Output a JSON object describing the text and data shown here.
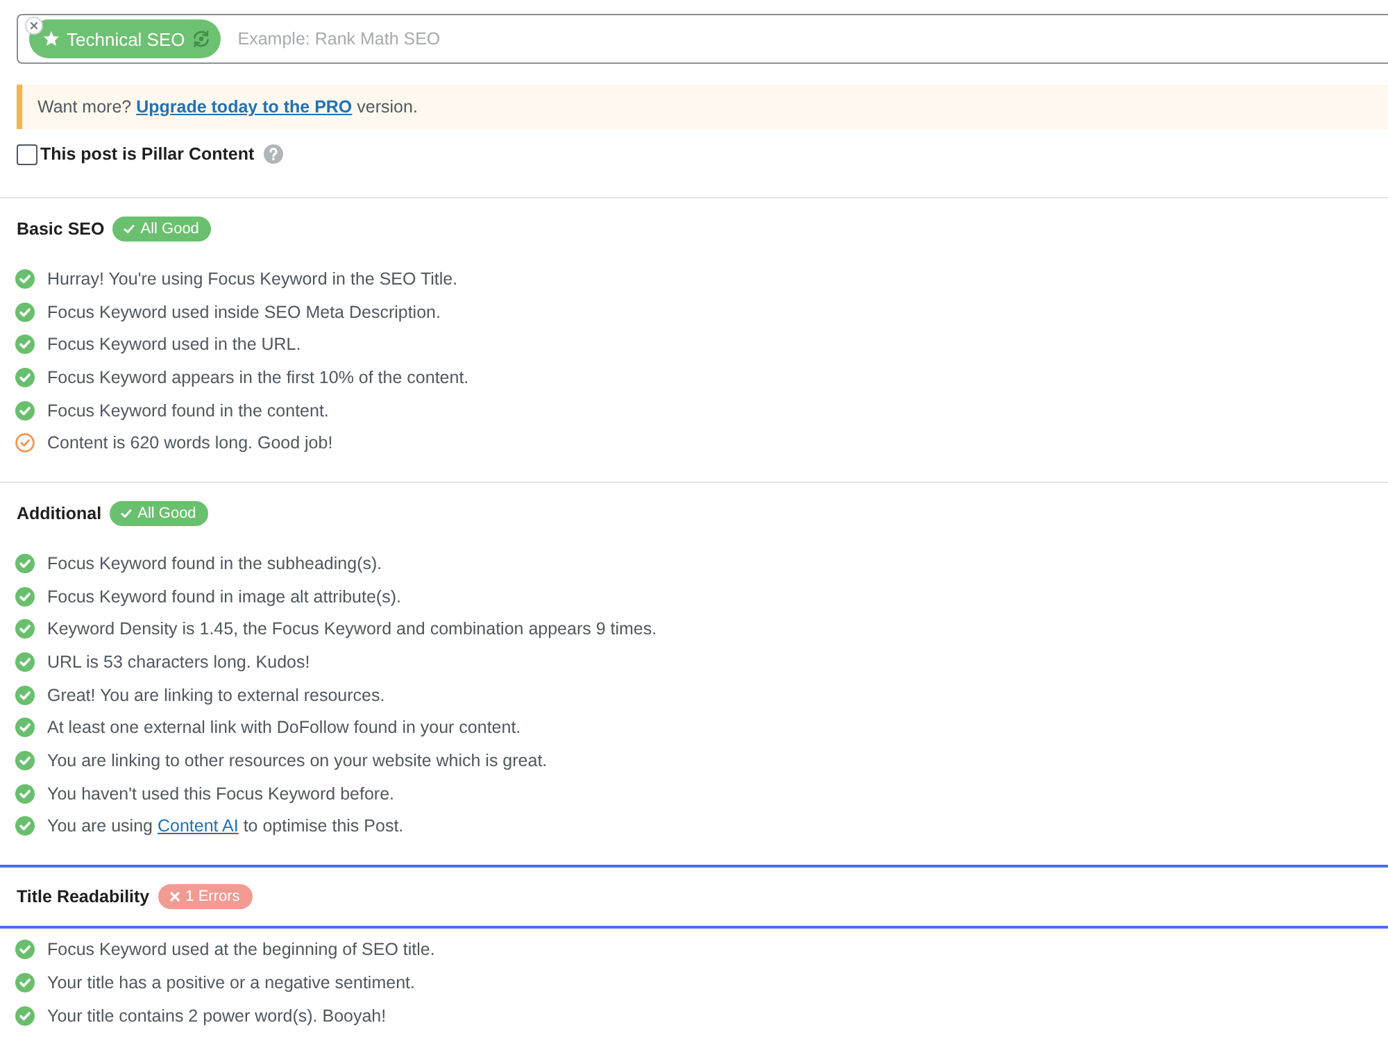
{
  "focus_keyword": {
    "tags": [
      {
        "label": "Technical SEO"
      }
    ],
    "placeholder": "Example: Rank Math SEO"
  },
  "notice": {
    "text": "Want more? ",
    "link": "Upgrade today to the PRO",
    "text_after": " version."
  },
  "pillar_content": {
    "label": "This post is Pillar Content",
    "checked": false
  },
  "sections": [
    {
      "title": "Basic SEO",
      "focused": false,
      "badge": {
        "kind": "good",
        "label": "All Good"
      },
      "items": [
        {
          "kind": "pass",
          "text": "Hurray! You're using Focus Keyword in the SEO Title."
        },
        {
          "kind": "pass",
          "text": "Focus Keyword used inside SEO Meta Description."
        },
        {
          "kind": "pass",
          "text": "Focus Keyword used in the URL."
        },
        {
          "kind": "pass",
          "text": "Focus Keyword appears in the first 10% of the content."
        },
        {
          "kind": "pass",
          "text": "Focus Keyword found in the content."
        },
        {
          "kind": "warning",
          "text": "Content is 620 words long. Good job!"
        }
      ]
    },
    {
      "title": "Additional",
      "focused": false,
      "badge": {
        "kind": "good",
        "label": "All Good"
      },
      "items": [
        {
          "kind": "pass",
          "text": "Focus Keyword found in the subheading(s)."
        },
        {
          "kind": "pass",
          "text": "Focus Keyword found in image alt attribute(s)."
        },
        {
          "kind": "pass",
          "text": "Keyword Density is 1.45, the Focus Keyword and combination appears 9 times."
        },
        {
          "kind": "pass",
          "text": "URL is 53 characters long. Kudos!"
        },
        {
          "kind": "pass",
          "text": "Great! You are linking to external resources."
        },
        {
          "kind": "pass",
          "text": "At least one external link with DoFollow found in your content."
        },
        {
          "kind": "pass",
          "text": "You are linking to other resources on your website which is great."
        },
        {
          "kind": "pass",
          "text": "You haven't used this Focus Keyword before."
        },
        {
          "kind": "pass",
          "text": "You are using ",
          "link": "Content AI",
          "text_after": " to optimise this Post."
        }
      ]
    },
    {
      "title": "Title Readability",
      "focused": true,
      "badge": {
        "kind": "error",
        "label": "1 Errors"
      },
      "items": [
        {
          "kind": "pass",
          "text": "Focus Keyword used at the beginning of SEO title."
        },
        {
          "kind": "pass",
          "text": "Your title has a positive or a negative sentiment."
        },
        {
          "kind": "pass",
          "text": "Your title contains 2 power word(s). Booyah!"
        }
      ]
    }
  ]
}
